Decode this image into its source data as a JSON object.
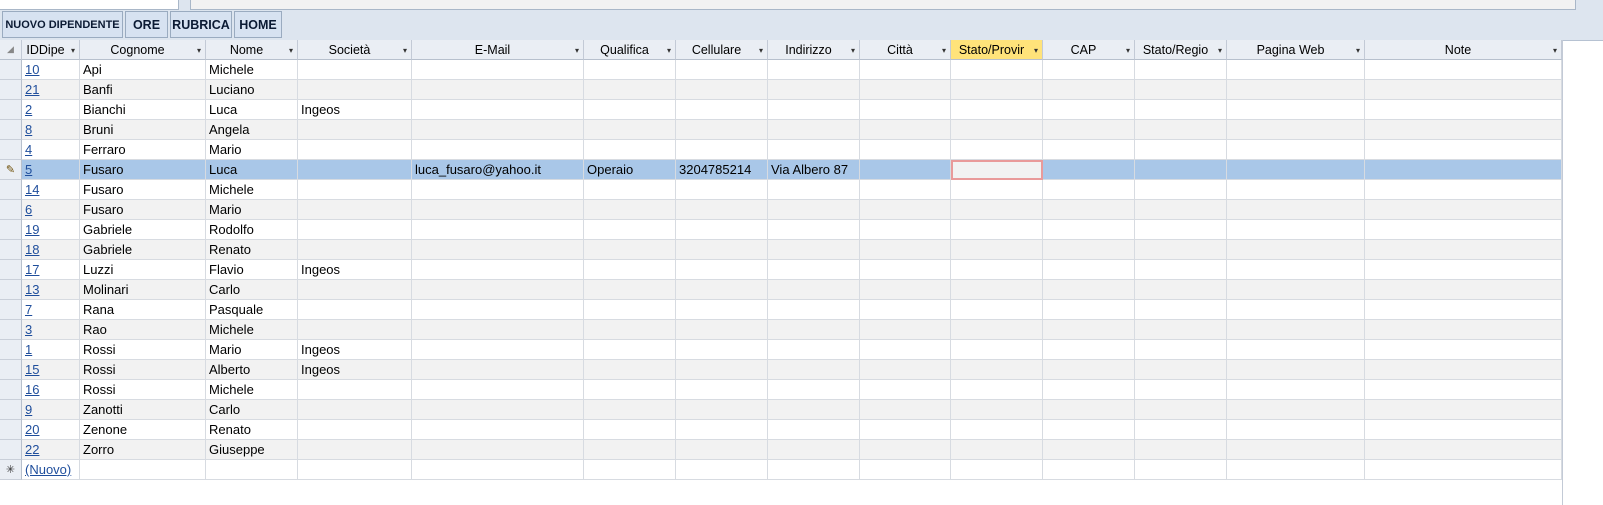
{
  "toolbar": {
    "buttons": [
      {
        "label": "NUOVO DIPENDENTE"
      },
      {
        "label": "ORE"
      },
      {
        "label": "RUBRICA"
      },
      {
        "label": "HOME"
      }
    ]
  },
  "table": {
    "columns": [
      "IDDipe",
      "Cognome",
      "Nome",
      "Società",
      "E-Mail",
      "Qualifica",
      "Cellulare",
      "Indirizzo",
      "Città",
      "Stato/Provir",
      "CAP",
      "Stato/Regio",
      "Pagina Web",
      "Note"
    ],
    "rows": [
      {
        "id": "10",
        "cognome": "Api",
        "nome": "Michele",
        "societa": "",
        "email": "",
        "qualifica": "",
        "cellulare": "",
        "indirizzo": ""
      },
      {
        "id": "21",
        "cognome": "Banfi",
        "nome": "Luciano",
        "societa": "",
        "email": "",
        "qualifica": "",
        "cellulare": "",
        "indirizzo": ""
      },
      {
        "id": "2",
        "cognome": "Bianchi",
        "nome": "Luca",
        "societa": "Ingeos",
        "email": "",
        "qualifica": "",
        "cellulare": "",
        "indirizzo": ""
      },
      {
        "id": "8",
        "cognome": "Bruni",
        "nome": "Angela",
        "societa": "",
        "email": "",
        "qualifica": "",
        "cellulare": "",
        "indirizzo": ""
      },
      {
        "id": "4",
        "cognome": "Ferraro",
        "nome": "Mario",
        "societa": "",
        "email": "",
        "qualifica": "",
        "cellulare": "",
        "indirizzo": ""
      },
      {
        "id": "5",
        "cognome": "Fusaro",
        "nome": "Luca",
        "societa": "",
        "email": "luca_fusaro@yahoo.it",
        "qualifica": "Operaio",
        "cellulare": "3204785214",
        "indirizzo": "Via Albero 87"
      },
      {
        "id": "14",
        "cognome": "Fusaro",
        "nome": "Michele",
        "societa": "",
        "email": "",
        "qualifica": "",
        "cellulare": "",
        "indirizzo": ""
      },
      {
        "id": "6",
        "cognome": "Fusaro",
        "nome": "Mario",
        "societa": "",
        "email": "",
        "qualifica": "",
        "cellulare": "",
        "indirizzo": ""
      },
      {
        "id": "19",
        "cognome": "Gabriele",
        "nome": "Rodolfo",
        "societa": "",
        "email": "",
        "qualifica": "",
        "cellulare": "",
        "indirizzo": ""
      },
      {
        "id": "18",
        "cognome": "Gabriele",
        "nome": "Renato",
        "societa": "",
        "email": "",
        "qualifica": "",
        "cellulare": "",
        "indirizzo": ""
      },
      {
        "id": "17",
        "cognome": "Luzzi",
        "nome": "Flavio",
        "societa": "Ingeos",
        "email": "",
        "qualifica": "",
        "cellulare": "",
        "indirizzo": ""
      },
      {
        "id": "13",
        "cognome": "Molinari",
        "nome": "Carlo",
        "societa": "",
        "email": "",
        "qualifica": "",
        "cellulare": "",
        "indirizzo": ""
      },
      {
        "id": "7",
        "cognome": "Rana",
        "nome": "Pasquale",
        "societa": "",
        "email": "",
        "qualifica": "",
        "cellulare": "",
        "indirizzo": ""
      },
      {
        "id": "3",
        "cognome": "Rao",
        "nome": "Michele",
        "societa": "",
        "email": "",
        "qualifica": "",
        "cellulare": "",
        "indirizzo": ""
      },
      {
        "id": "1",
        "cognome": "Rossi",
        "nome": "Mario",
        "societa": "Ingeos",
        "email": "",
        "qualifica": "",
        "cellulare": "",
        "indirizzo": ""
      },
      {
        "id": "15",
        "cognome": "Rossi",
        "nome": "Alberto",
        "societa": "Ingeos",
        "email": "",
        "qualifica": "",
        "cellulare": "",
        "indirizzo": ""
      },
      {
        "id": "16",
        "cognome": "Rossi",
        "nome": "Michele",
        "societa": "",
        "email": "",
        "qualifica": "",
        "cellulare": "",
        "indirizzo": ""
      },
      {
        "id": "9",
        "cognome": "Zanotti",
        "nome": "Carlo",
        "societa": "",
        "email": "",
        "qualifica": "",
        "cellulare": "",
        "indirizzo": ""
      },
      {
        "id": "20",
        "cognome": "Zenone",
        "nome": "Renato",
        "societa": "",
        "email": "",
        "qualifica": "",
        "cellulare": "",
        "indirizzo": ""
      },
      {
        "id": "22",
        "cognome": "Zorro",
        "nome": "Giuseppe",
        "societa": "",
        "email": "",
        "qualifica": "",
        "cellulare": "",
        "indirizzo": ""
      }
    ],
    "new_row_label": "(Nuovo)",
    "selected_row": 5,
    "selected_column": 9,
    "selector_icons": {
      "editing": "pencil-icon",
      "new": "asterisk-icon"
    }
  },
  "colors": {
    "header_bg": "#eaeef4",
    "selected_header": "#ffe37a",
    "selected_row": "#a9c7e8",
    "row_alt": "#f2f2f2",
    "link": "#1f4e9c"
  }
}
